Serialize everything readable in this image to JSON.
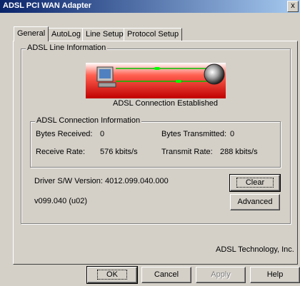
{
  "window": {
    "title": "ADSL PCI WAN Adapter",
    "close_glyph": "x"
  },
  "tabs": [
    "General",
    "AutoLog",
    "Line Setup",
    "Protocol Setup"
  ],
  "line_info": {
    "legend": "ADSL Line Information",
    "status": "ADSL Connection Established"
  },
  "connection": {
    "legend": "ADSL Connection Information",
    "bytes_received_label": "Bytes Received:",
    "bytes_received_value": "0",
    "bytes_transmitted_label": "Bytes Transmitted:",
    "bytes_transmitted_value": "0",
    "receive_rate_label": "Receive Rate:",
    "receive_rate_value": "576 kbits/s",
    "transmit_rate_label": "Transmit Rate:",
    "transmit_rate_value": "288 kbits/s"
  },
  "driver": {
    "version_text": "Driver S/W Version: 4012.099.040.000",
    "firmware": "v099.040 (u02)"
  },
  "buttons": {
    "clear": "Clear",
    "advanced": "Advanced",
    "ok": "OK",
    "cancel": "Cancel",
    "apply": "Apply",
    "help": "Help"
  },
  "vendor": "ADSL Technology, Inc."
}
